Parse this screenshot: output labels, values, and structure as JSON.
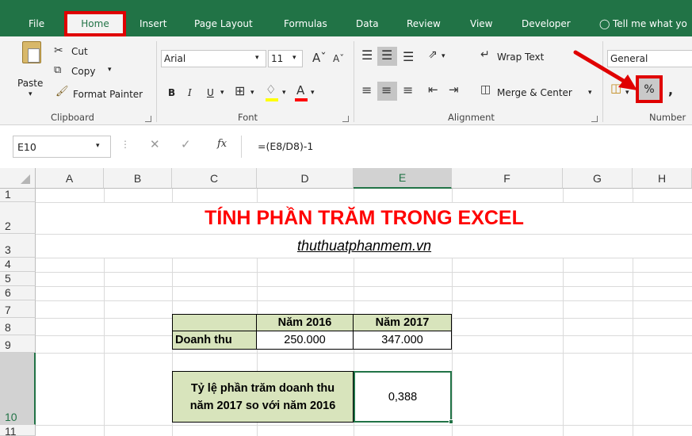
{
  "tabs": [
    "File",
    "Home",
    "Insert",
    "Page Layout",
    "Formulas",
    "Data",
    "Review",
    "View",
    "Developer"
  ],
  "tell_me": "Tell me what yo",
  "clipboard": {
    "paste": "Paste",
    "cut": "Cut",
    "copy": "Copy",
    "format_painter": "Format Painter",
    "group": "Clipboard"
  },
  "font": {
    "name": "Arial",
    "size": "11",
    "bold": "B",
    "italic": "I",
    "underline": "U",
    "group": "Font"
  },
  "alignment": {
    "wrap": "Wrap Text",
    "merge": "Merge & Center",
    "group": "Alignment"
  },
  "number": {
    "format": "General",
    "percent": "%",
    "comma": ",",
    "group": "Number"
  },
  "formula_bar": {
    "name_box": "E10",
    "fx": "fx",
    "formula": "=(E8/D8)-1"
  },
  "columns": [
    "A",
    "B",
    "C",
    "D",
    "E",
    "F",
    "G",
    "H"
  ],
  "rows": [
    "1",
    "2",
    "3",
    "4",
    "5",
    "6",
    "7",
    "8",
    "9",
    "10",
    "11"
  ],
  "sheet": {
    "title": "TÍNH PHẦN TRĂM TRONG EXCEL",
    "subtitle": "thuthuatphanmem.vn",
    "header_2016": "Năm 2016",
    "header_2017": "Năm 2017",
    "row_label": "Doanh thu",
    "value_2016": "250.000",
    "value_2017": "347.000",
    "ratio_label_1": "Tỷ lệ phần trăm doanh thu",
    "ratio_label_2": "năm 2017 so với năm 2016",
    "ratio_value": "0,388"
  },
  "colors": {
    "ribbon_green": "#217346",
    "highlight_red": "#e00000",
    "title_red": "#ff0000",
    "cell_green": "#d8e4bc"
  }
}
